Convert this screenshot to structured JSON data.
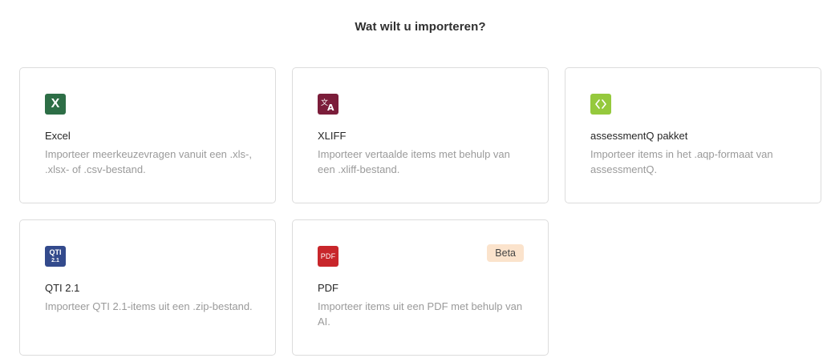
{
  "heading": "Wat wilt u importeren?",
  "options": [
    {
      "icon": "excel-icon",
      "icon_text": "X",
      "color": "#2d6e46",
      "name": "Excel",
      "description": "Importeer meerkeuzevragen vanuit een .xls-, .xlsx- of .csv-bestand."
    },
    {
      "icon": "translate-icon",
      "color": "#7b1d3a",
      "name": "XLIFF",
      "description": "Importeer vertaalde items met behulp van een .xliff-bestand."
    },
    {
      "icon": "code-brackets-icon",
      "color": "#95c93d",
      "name": "assessmentQ pakket",
      "description": "Importeer items in het .aqp-formaat van assessmentQ."
    },
    {
      "icon": "qti-icon",
      "icon_text_top": "QTI",
      "icon_text_bottom": "2.1",
      "color": "#334a8c",
      "name": "QTI 2.1",
      "description": "Importeer QTI 2.1-items uit een .zip-bestand."
    },
    {
      "icon": "pdf-icon",
      "icon_text": "PDF",
      "color": "#c8262b",
      "name": "PDF",
      "description": "Importeer items uit een PDF met behulp van AI.",
      "badge": "Beta",
      "badge_color": "#fbe3cc"
    }
  ]
}
